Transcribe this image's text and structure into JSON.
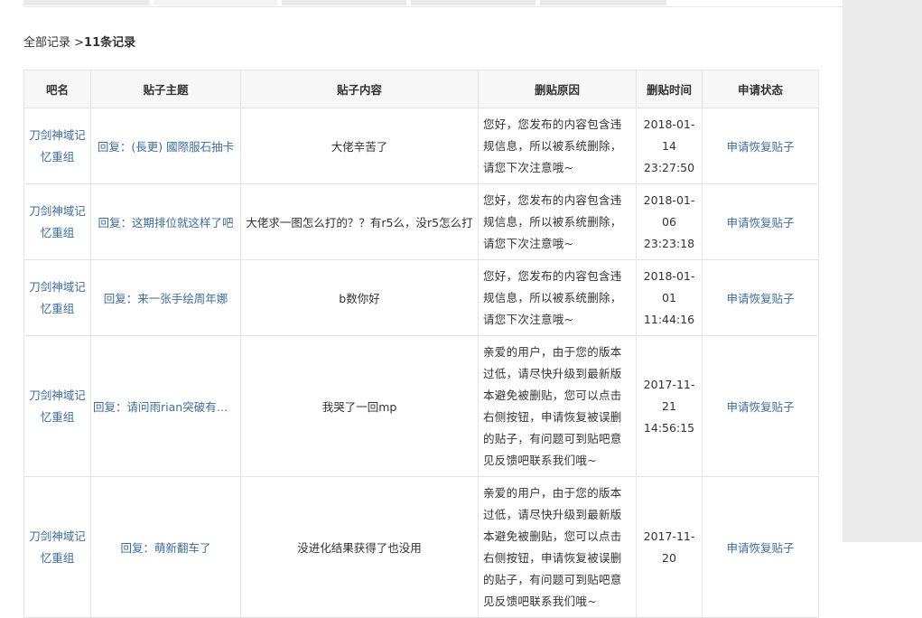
{
  "breadcrumb": {
    "root": "全部记录",
    "separator": " >",
    "count": "11条记录"
  },
  "table": {
    "columns": [
      "吧名",
      "贴子主题",
      "贴子内容",
      "删贴原因",
      "删贴时间",
      "申请状态"
    ],
    "rows": [
      {
        "forum": "刀剑神域记忆重组",
        "topic": "回复：(長更) 國際服石抽卡",
        "content": "大佬辛苦了",
        "reason": "您好，您发布的内容包含违规信息，所以被系统删除，请您下次注意哦~",
        "date": "2018-01-14",
        "time": "23:27:50",
        "status": "申请恢复贴子"
      },
      {
        "forum": "刀剑神域记忆重组",
        "topic": "回复：这期排位就这样了吧",
        "content": "大佬求一图怎么打的？？有r5么，没r5怎么打",
        "reason": "您好，您发布的内容包含违规信息，所以被系统删除，请您下次注意哦~",
        "date": "2018-01-06",
        "time": "23:23:18",
        "status": "申请恢复贴子"
      },
      {
        "forum": "刀剑神域记忆重组",
        "topic": "回复：来一张手绘周年娜",
        "content": "b数你好",
        "reason": "您好，您发布的内容包含违规信息，所以被系统删除，请您下次注意哦~",
        "date": "2018-01-01",
        "time": "11:44:16",
        "status": "申请恢复贴子"
      },
      {
        "forum": "刀剑神域记忆重组",
        "topic": "回复：请问雨rian突破有什么用",
        "content": "我哭了一回mp",
        "reason": "亲爱的用户，由于您的版本过低，请尽快升级到最新版本避免被删贴，您可以点击右侧按钮，申请恢复被误删的贴子，有问题可到贴吧意见反馈吧联系我们哦~",
        "date": "2017-11-21",
        "time": "14:56:15",
        "status": "申请恢复贴子"
      },
      {
        "forum": "刀剑神域记忆重组",
        "topic": "回复：萌新翻车了",
        "content": "没进化结果获得了也没用",
        "reason": "亲爱的用户，由于您的版本过低，请尽快升级到最新版本避免被删贴，您可以点击右侧按钮，申请恢复被误删的贴子，有问题可到贴吧意见反馈吧联系我们哦~",
        "date": "2017-11-20",
        "time": "",
        "status": "申请恢复贴子"
      }
    ]
  },
  "colors": {
    "link": "#3a6da3",
    "header_bg": "#f7f7f7",
    "border": "#e4e4e4",
    "side_panel": "#ebebeb"
  }
}
